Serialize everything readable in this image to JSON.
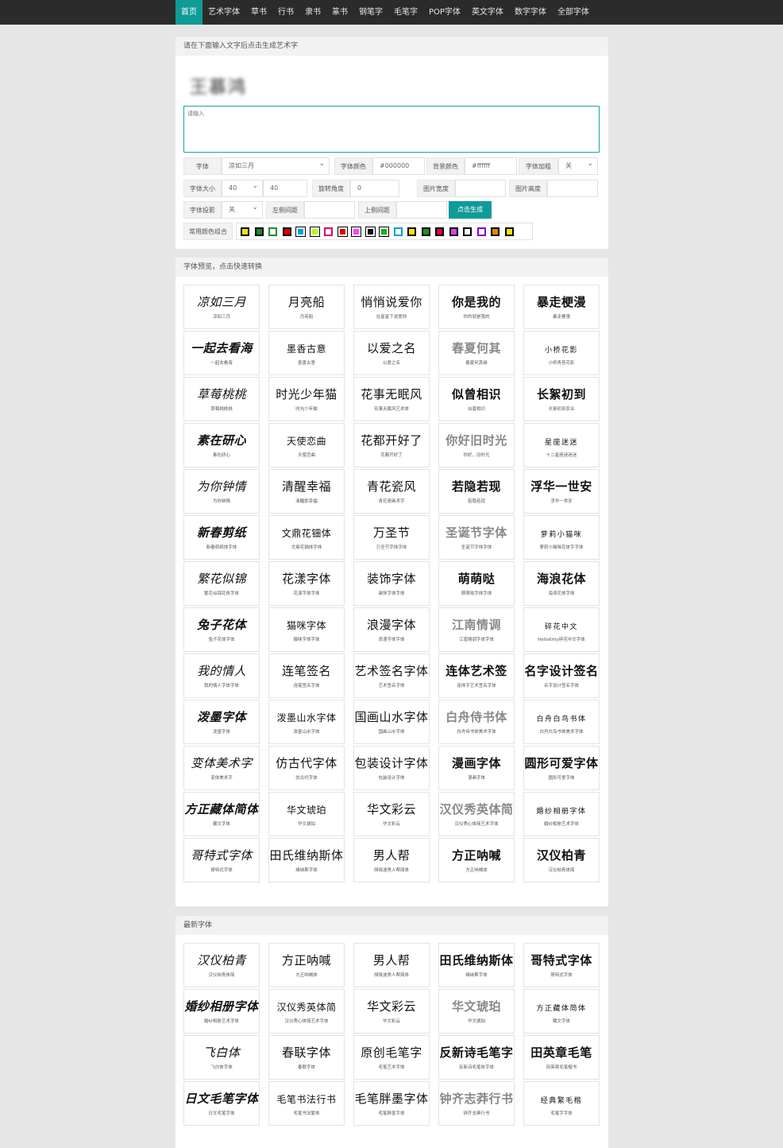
{
  "nav": {
    "items": [
      "首页",
      "艺术字体",
      "草书",
      "行书",
      "隶书",
      "篆书",
      "钢笔字",
      "毛笔字",
      "POP字体",
      "英文字体",
      "数字字体",
      "全部字体"
    ],
    "active": 0
  },
  "generator": {
    "heading": "请在下面输入文字后点击生成艺术字",
    "preview_text": "王慕鸿",
    "text_placeholder": "请输入",
    "labels": {
      "font": "字体",
      "font_color": "字体颜色",
      "bg_color": "背景颜色",
      "bold": "字体加粗",
      "size": "字体大小",
      "rotation": "旋转角度",
      "img_width": "图片宽度",
      "img_height": "图片高度",
      "shadow": "字体投影",
      "left_spacing": "左侧间距",
      "top_spacing": "上侧间距",
      "color_combos": "常用颜色组合"
    },
    "values": {
      "font": "凉如三月",
      "font_color": "#000000",
      "bg_color": "#ffffff",
      "bold": "关",
      "size_select": "40",
      "size_input": "40",
      "rotation": "0",
      "img_width": "",
      "img_height": "",
      "shadow": "关",
      "left_spacing": "",
      "top_spacing": ""
    },
    "generate_label": "点击生成",
    "swatches": [
      {
        "border": "#000000",
        "fill": "#f5e400"
      },
      {
        "border": "#000000",
        "fill": "#1e8c2a"
      },
      {
        "border": "#1e8c2a",
        "fill": "#ffffff"
      },
      {
        "border": "#000000",
        "fill": "#e00000"
      },
      {
        "border": "#ffffff",
        "fill": "#00a0e0"
      },
      {
        "border": "#ffffff",
        "fill": "#b4ff00"
      },
      {
        "border": "#e0006a",
        "fill": "#ffffff"
      },
      {
        "border": "#ffffff",
        "fill": "#e00000"
      },
      {
        "border": "#ffffff",
        "fill": "#ff40ff"
      },
      {
        "border": "#ffffff",
        "fill": "#111111"
      },
      {
        "border": "#ffffff",
        "fill": "#22aa22"
      },
      {
        "border": "#00a0e0",
        "fill": "#ffffff"
      },
      {
        "border": "#000000",
        "fill": "#f5e400"
      },
      {
        "border": "#000000",
        "fill": "#1e8c2a"
      },
      {
        "border": "#000000",
        "fill": "#e00040"
      },
      {
        "border": "#000000",
        "fill": "#e040e0"
      },
      {
        "border": "#000000",
        "fill": "#ffffff"
      },
      {
        "border": "#8800cc",
        "fill": "#ffffff"
      },
      {
        "border": "#000000",
        "fill": "#e08800"
      },
      {
        "border": "#000000",
        "fill": "#f5e400"
      }
    ]
  },
  "fonts_section": {
    "heading": "字体预览，点击快速转换",
    "cards": [
      {
        "art": "凉如三月",
        "name": "凉如三月"
      },
      {
        "art": "月亮船",
        "name": "月亮船"
      },
      {
        "art": "悄悄说爱你",
        "name": "在星星下说爱你"
      },
      {
        "art": "你是我的",
        "name": "你的就是我的"
      },
      {
        "art": "暴走梗漫",
        "name": "暴走梗漫"
      },
      {
        "art": "一起去看海",
        "name": "一起去看海"
      },
      {
        "art": "墨香古意",
        "name": "墨香古意"
      },
      {
        "art": "以爱之名",
        "name": "以爱之名"
      },
      {
        "art": "春夏何其",
        "name": "春夏何其缘"
      },
      {
        "art": "小桥花影",
        "name": "小桥青苔花影"
      },
      {
        "art": "草莓桃桃",
        "name": "草莓桃桃桃"
      },
      {
        "art": "时光少年猫",
        "name": "时光少年猫"
      },
      {
        "art": "花事无眠风",
        "name": "花事无眠风艺术体"
      },
      {
        "art": "似曾相识",
        "name": "似曾相识"
      },
      {
        "art": "长絮初到",
        "name": "长絮初到农业"
      },
      {
        "art": "素在研心",
        "name": "素在研心"
      },
      {
        "art": "天使恋曲",
        "name": "天使恋曲"
      },
      {
        "art": "花都开好了",
        "name": "花都开好了"
      },
      {
        "art": "你好旧时光",
        "name": "你好，旧时光"
      },
      {
        "art": "星座迷迷",
        "name": "十二星座迷迷迷"
      },
      {
        "art": "为你钟情",
        "name": "为你钟情"
      },
      {
        "art": "清醒幸福",
        "name": "清醒即幸福"
      },
      {
        "art": "青花瓷风",
        "name": "青花瓷画术字"
      },
      {
        "art": "若隐若现",
        "name": "若隐若现"
      },
      {
        "art": "浮华一世安",
        "name": "浮华一世安"
      },
      {
        "art": "新春剪纸",
        "name": "新春剪纸体字体"
      },
      {
        "art": "文鼎花钿体",
        "name": "文鼎花钿体字体"
      },
      {
        "art": "万圣节",
        "name": "万圣节字体字体"
      },
      {
        "art": "圣诞节字体",
        "name": "圣诞节字体字体"
      },
      {
        "art": "萝莉小猫咪",
        "name": "萝莉小猫咪花体字字体"
      },
      {
        "art": "繁花似锦",
        "name": "繁花似锦花体字体"
      },
      {
        "art": "花漾字体",
        "name": "花漾字体字体"
      },
      {
        "art": "装饰字体",
        "name": "装饰字体字体"
      },
      {
        "art": "萌萌哒",
        "name": "萌萌哒字体字体"
      },
      {
        "art": "海浪花体",
        "name": "海浪花体字体"
      },
      {
        "art": "兔子花体",
        "name": "兔子花体字体"
      },
      {
        "art": "猫咪字体",
        "name": "猫咪字体字体"
      },
      {
        "art": "浪漫字体",
        "name": "浪漫字体字体"
      },
      {
        "art": "江南情调",
        "name": "江南情调字体字体"
      },
      {
        "art": "碎花中文",
        "name": "HelloKitty碎花中文字体"
      },
      {
        "art": "我的情人",
        "name": "我的情人字体字体"
      },
      {
        "art": "连笔签名",
        "name": "连笔签名字体"
      },
      {
        "art": "艺术签名字体",
        "name": "艺术签名字体"
      },
      {
        "art": "连体艺术签",
        "name": "连体字艺术签名字体"
      },
      {
        "art": "名字设计签名",
        "name": "名字设计签名字体"
      },
      {
        "art": "泼墨字体",
        "name": "泼墨字体"
      },
      {
        "art": "泼墨山水字体",
        "name": "泼墨山水字体"
      },
      {
        "art": "国画山水字体",
        "name": "国画山水字体"
      },
      {
        "art": "白舟侍书体",
        "name": "白舟侍书体美术字体"
      },
      {
        "art": "白舟白鸟书体",
        "name": "白舟白鸟书体美术字体"
      },
      {
        "art": "变体美术字",
        "name": "变体美术字"
      },
      {
        "art": "仿古代字体",
        "name": "仿古代字体"
      },
      {
        "art": "包装设计字体",
        "name": "包装设计字体"
      },
      {
        "art": "漫画字体",
        "name": "漫画字体"
      },
      {
        "art": "圆形可爱字体",
        "name": "圆形可爱字体"
      },
      {
        "art": "方正藏体简体",
        "name": "藏文字体"
      },
      {
        "art": "华文琥珀",
        "name": "华文琥珀"
      },
      {
        "art": "华文彩云",
        "name": "华文彩云"
      },
      {
        "art": "汉仪秀英体简",
        "name": "汉仪秀心体简艺术字体"
      },
      {
        "art": "婚纱相册字体",
        "name": "婚纱相册艺术字体"
      },
      {
        "art": "哥特式字体",
        "name": "哥特式字体"
      },
      {
        "art": "田氏维纳斯体",
        "name": "维纳斯字体"
      },
      {
        "art": "男人帮",
        "name": "胡晓波男人帮简体"
      },
      {
        "art": "方正呐喊",
        "name": "方正呐喊体"
      },
      {
        "art": "汉仪柏青",
        "name": "汉仪柏青体简"
      }
    ]
  },
  "latest_section": {
    "heading": "最新字体",
    "cards": [
      {
        "art": "汉仪柏青",
        "name": "汉仪柏青体简"
      },
      {
        "art": "方正呐喊",
        "name": "方正呐喊体"
      },
      {
        "art": "男人帮",
        "name": "胡晓波男人帮简体"
      },
      {
        "art": "田氏维纳斯体",
        "name": "维纳斯字体"
      },
      {
        "art": "哥特式字体",
        "name": "哥特式字体"
      },
      {
        "art": "婚纱相册字体",
        "name": "婚纱相册艺术字体"
      },
      {
        "art": "汉仪秀英体简",
        "name": "汉仪秀心体简艺术字体"
      },
      {
        "art": "华文彩云",
        "name": "华文彩云"
      },
      {
        "art": "华文琥珀",
        "name": "华文琥珀"
      },
      {
        "art": "方正藏体简体",
        "name": "藏文字体"
      },
      {
        "art": "飞白体",
        "name": "飞白体字体"
      },
      {
        "art": "春联字体",
        "name": "春联字体"
      },
      {
        "art": "原创毛笔字",
        "name": "毛笔艺术字体"
      },
      {
        "art": "反新诗毛笔字",
        "name": "反新诗毛笔体字体"
      },
      {
        "art": "田英章毛笔",
        "name": "田英章毛笔楷书"
      },
      {
        "art": "日文毛笔字体",
        "name": "日文毛笔字体"
      },
      {
        "art": "毛笔书法行书",
        "name": "毛笔书法繁体"
      },
      {
        "art": "毛笔胖墨字体",
        "name": "毛笔胖墨字体"
      },
      {
        "art": "钟齐志莽行书",
        "name": "钟齐志莽行书"
      },
      {
        "art": "经典繁毛楷",
        "name": "毛笔字字体"
      }
    ]
  }
}
